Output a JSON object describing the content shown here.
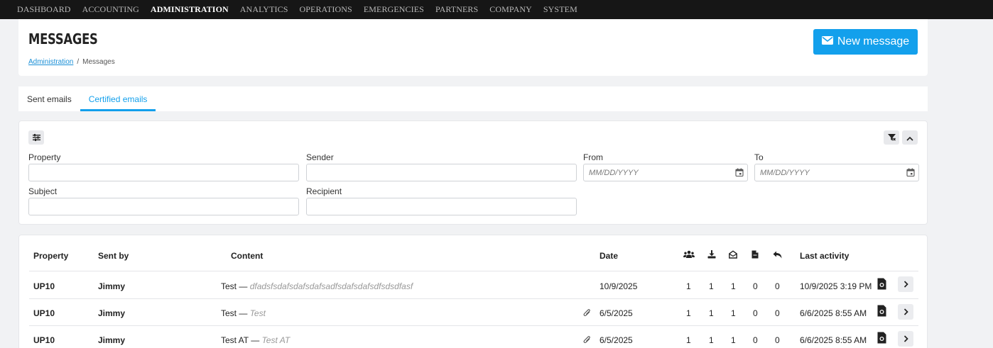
{
  "topnav": {
    "items": [
      {
        "label": "DASHBOARD",
        "active": false
      },
      {
        "label": "ACCOUNTING",
        "active": false
      },
      {
        "label": "ADMINISTRATION",
        "active": true
      },
      {
        "label": "ANALYTICS",
        "active": false
      },
      {
        "label": "OPERATIONS",
        "active": false
      },
      {
        "label": "EMERGENCIES",
        "active": false
      },
      {
        "label": "PARTNERS",
        "active": false
      },
      {
        "label": "COMPANY",
        "active": false
      },
      {
        "label": "SYSTEM",
        "active": false
      }
    ]
  },
  "header": {
    "title": "MESSAGES",
    "breadcrumb_link": "Administration",
    "breadcrumb_sep": "/",
    "breadcrumb_current": "Messages",
    "new_message_label": "New message",
    "new_message_icon": "envelope-icon"
  },
  "tabs": [
    {
      "label": "Sent emails",
      "active": false
    },
    {
      "label": "Certified emails",
      "active": true
    }
  ],
  "filters": {
    "property_label": "Property",
    "property_value": "",
    "sender_label": "Sender",
    "sender_value": "",
    "from_label": "From",
    "from_placeholder": "MM/DD/YYYY",
    "to_label": "To",
    "to_placeholder": "MM/DD/YYYY",
    "subject_label": "Subject",
    "subject_value": "",
    "recipient_label": "Recipient",
    "recipient_value": ""
  },
  "table": {
    "headers": {
      "property": "Property",
      "sent_by": "Sent by",
      "content": "Content",
      "date": "Date",
      "recipients_icon": "users-icon",
      "downloaded_icon": "download-icon",
      "opened_icon": "envelope-open-icon",
      "document_icon": "file-icon",
      "replied_icon": "reply-icon",
      "last_activity": "Last activity"
    },
    "rows": [
      {
        "property": "UP10",
        "sent_by": "Jimmy",
        "subject": "Test",
        "dash": " — ",
        "preview": "dfadsfsdafsdafsdafsadfsdafsdafsdfsdsdfasf",
        "attachment": false,
        "date": "10/9/2025",
        "c1": "1",
        "c2": "1",
        "c3": "1",
        "c4": "0",
        "c5": "0",
        "last_activity": "10/9/2025 3:19 PM"
      },
      {
        "property": "UP10",
        "sent_by": "Jimmy",
        "subject": "Test",
        "dash": " — ",
        "preview": "Test",
        "attachment": true,
        "date": "6/5/2025",
        "c1": "1",
        "c2": "1",
        "c3": "1",
        "c4": "0",
        "c5": "0",
        "last_activity": "6/6/2025 8:55 AM"
      },
      {
        "property": "UP10",
        "sent_by": "Jimmy",
        "subject": "Test AT",
        "dash": " — ",
        "preview": "Test AT",
        "attachment": true,
        "date": "6/5/2025",
        "c1": "1",
        "c2": "1",
        "c3": "1",
        "c4": "0",
        "c5": "0",
        "last_activity": "6/6/2025 8:55 AM"
      }
    ]
  },
  "colors": {
    "accent": "#13a0ec",
    "nav_bg": "#161616",
    "page_bg": "#f1f2f4"
  }
}
